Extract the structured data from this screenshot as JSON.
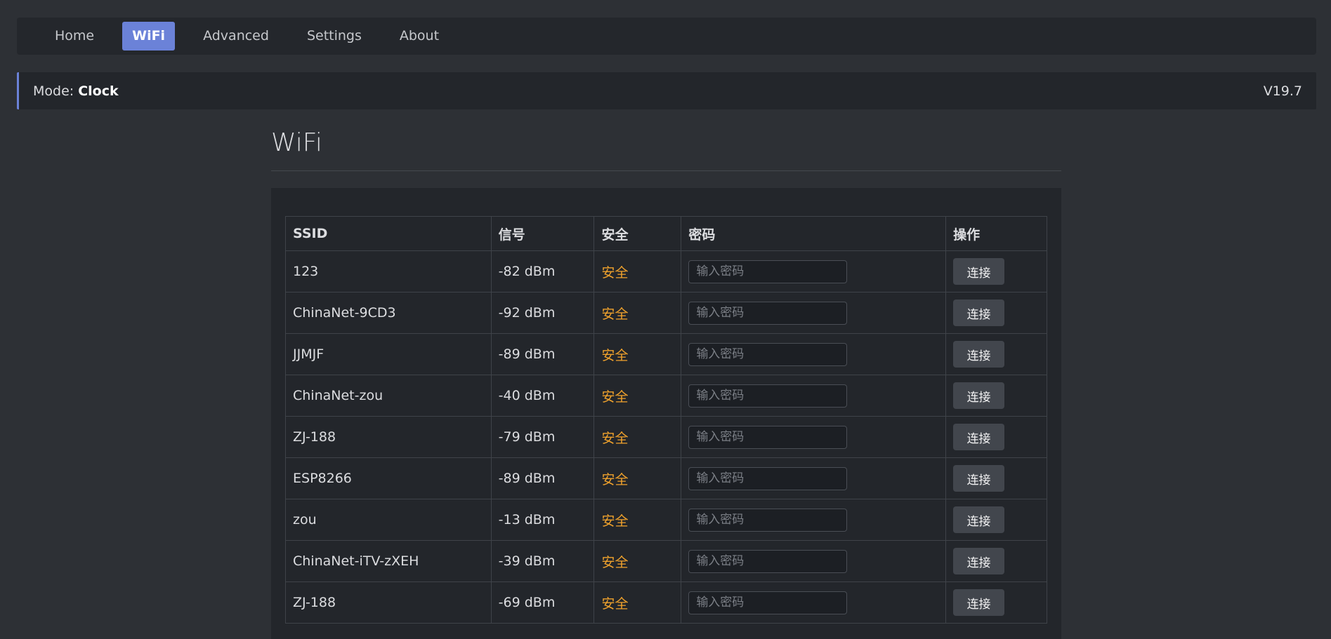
{
  "nav": {
    "items": [
      {
        "label": "Home",
        "active": false
      },
      {
        "label": "WiFi",
        "active": true
      },
      {
        "label": "Advanced",
        "active": false
      },
      {
        "label": "Settings",
        "active": false
      },
      {
        "label": "About",
        "active": false
      }
    ]
  },
  "status": {
    "mode_label": "Mode: ",
    "mode_value": "Clock",
    "version": "V19.7"
  },
  "page": {
    "title": "WiFi"
  },
  "table": {
    "headers": {
      "ssid": "SSID",
      "signal": "信号",
      "security": "安全",
      "password": "密码",
      "action": "操作"
    },
    "password_placeholder": "输入密码",
    "connect_label": "连接",
    "rows": [
      {
        "ssid": "123",
        "signal": "-82 dBm",
        "security": "安全"
      },
      {
        "ssid": "ChinaNet-9CD3",
        "signal": "-92 dBm",
        "security": "安全"
      },
      {
        "ssid": "JJMJF",
        "signal": "-89 dBm",
        "security": "安全"
      },
      {
        "ssid": "ChinaNet-zou",
        "signal": "-40 dBm",
        "security": "安全"
      },
      {
        "ssid": "ZJ-188",
        "signal": "-79 dBm",
        "security": "安全"
      },
      {
        "ssid": "ESP8266",
        "signal": "-89 dBm",
        "security": "安全"
      },
      {
        "ssid": "zou",
        "signal": "-13 dBm",
        "security": "安全"
      },
      {
        "ssid": "ChinaNet-iTV-zXEH",
        "signal": "-39 dBm",
        "security": "安全"
      },
      {
        "ssid": "ZJ-188",
        "signal": "-69 dBm",
        "security": "安全"
      }
    ]
  },
  "colors": {
    "accent": "#6b82d8",
    "security_text": "#f0a22c",
    "background": "#2d3035"
  }
}
